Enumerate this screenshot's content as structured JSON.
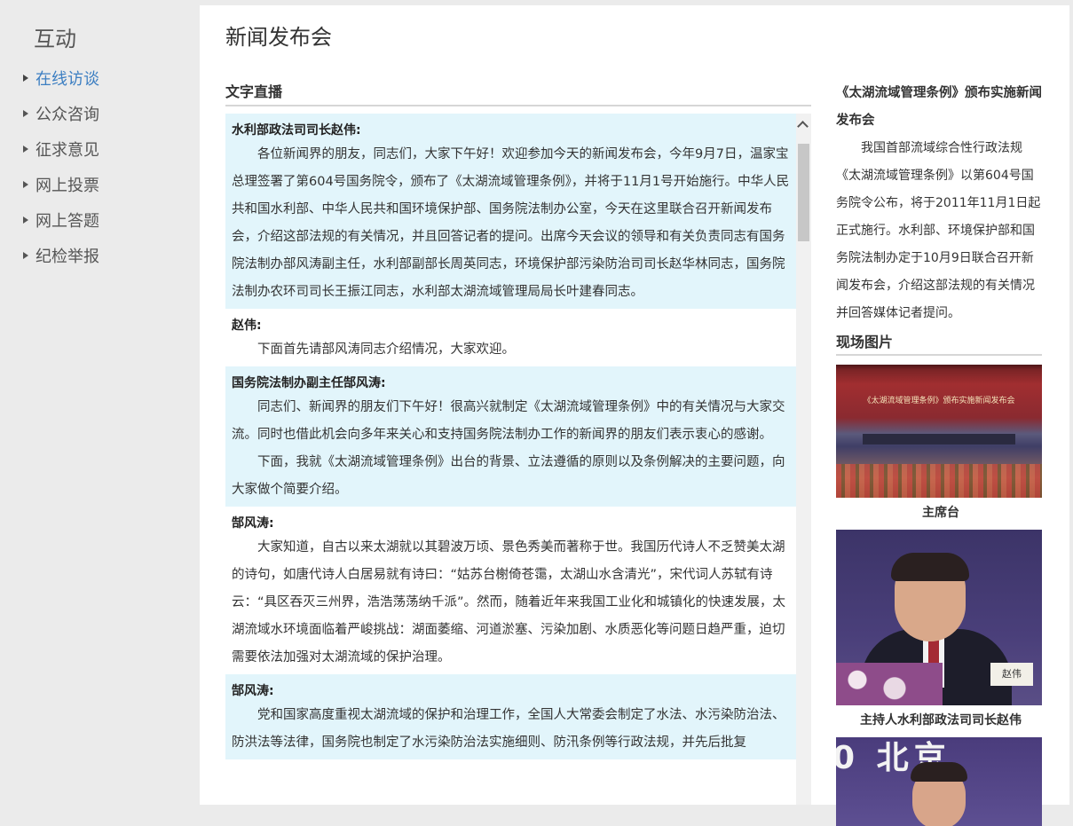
{
  "sidebar": {
    "title": "互动",
    "items": [
      {
        "label": "在线访谈",
        "active": true
      },
      {
        "label": "公众咨询"
      },
      {
        "label": "征求意见"
      },
      {
        "label": "网上投票"
      },
      {
        "label": "网上答题"
      },
      {
        "label": "纪检举报"
      }
    ]
  },
  "page": {
    "title": "新闻发布会",
    "live_title": "文字直播"
  },
  "live": {
    "entries": [
      {
        "speaker": "水利部政法司司长赵伟:",
        "paragraphs": [
          "各位新闻界的朋友，同志们，大家下午好！欢迎参加今天的新闻发布会，今年9月7日，温家宝总理签署了第604号国务院令，颁布了《太湖流域管理条例》，并将于11月1号开始施行。中华人民共和国水利部、中华人民共和国环境保护部、国务院法制办公室，今天在这里联合召开新闻发布会，介绍这部法规的有关情况，并且回答记者的提问。出席今天会议的领导和有关负责同志有国务院法制办部风涛副主任，水利部副部长周英同志，环境保护部污染防治司司长赵华林同志，国务院法制办农环司司长王振江同志，水利部太湖流域管理局局长叶建春同志。"
        ]
      },
      {
        "speaker": "赵伟:",
        "paragraphs": [
          "下面首先请部风涛同志介绍情况，大家欢迎。"
        ]
      },
      {
        "speaker": "国务院法制办副主任郜风涛:",
        "paragraphs": [
          "同志们、新闻界的朋友们下午好！很高兴就制定《太湖流域管理条例》中的有关情况与大家交流。同时也借此机会向多年来关心和支持国务院法制办工作的新闻界的朋友们表示衷心的感谢。",
          "下面，我就《太湖流域管理条例》出台的背景、立法遵循的原则以及条例解决的主要问题，向大家做个简要介绍。"
        ]
      },
      {
        "speaker": "郜风涛:",
        "paragraphs": [
          "大家知道，自古以来太湖就以其碧波万顷、景色秀美而著称于世。我国历代诗人不乏赞美太湖的诗句，如唐代诗人白居易就有诗曰：“姑苏台榭倚苍霭，太湖山水含清光”，宋代词人苏轼有诗云：“具区吞灭三州界，浩浩荡荡纳千派”。然而，随着近年来我国工业化和城镇化的快速发展，太湖流域水环境面临着严峻挑战：湖面萎缩、河道淤塞、污染加剧、水质恶化等问题日趋严重，迫切需要依法加强对太湖流域的保护治理。"
        ]
      },
      {
        "speaker": "郜风涛:",
        "paragraphs": [
          "党和国家高度重视太湖流域的保护和治理工作，全国人大常委会制定了水法、水污染防治法、防洪法等法律，国务院也制定了水污染防治法实施细则、防汛条例等行政法规，并先后批复"
        ]
      }
    ]
  },
  "side": {
    "headline": "《太湖流域管理条例》颁布实施新闻发布会",
    "summary": "我国首部流域综合性行政法规《太湖流域管理条例》以第604号国务院令公布，将于2011年11月1日起正式施行。水利部、环境保护部和国务院法制办定于10月9日联合召开新闻发布会，介绍这部法规的有关情况并回答媒体记者提问。",
    "photos_title": "现场图片",
    "photos": [
      {
        "caption": "主席台",
        "banner": "《太湖流域管理条例》颁布实施新闻发布会"
      },
      {
        "caption": "主持人水利部政法司司长赵伟",
        "plate": "赵伟"
      },
      {
        "caption": "",
        "overlay": "0 北京"
      }
    ]
  }
}
